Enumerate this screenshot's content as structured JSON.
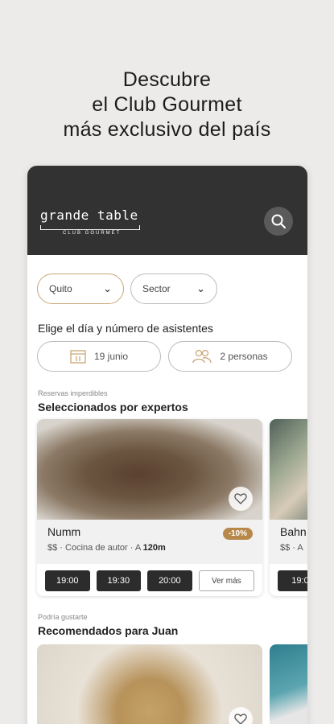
{
  "headline": {
    "line1": "Descubre",
    "line2": "el Club Gourmet",
    "line3": "más exclusivo del país"
  },
  "header": {
    "logo_main": "grande table",
    "logo_sub": "CLUB GOURMET"
  },
  "filters": {
    "city": "Quito",
    "sector": "Sector"
  },
  "pick": {
    "label": "Elige el día y número de asistentes",
    "date": "19 junio",
    "people": "2 personas"
  },
  "section1": {
    "small": "Reservas imperdibles",
    "title": "Seleccionados por expertos"
  },
  "restaurants": [
    {
      "name": "Numm",
      "price": "$$",
      "cuisine": "Cocina de autor",
      "distance_prefix": "A",
      "distance": "120m",
      "discount": "-10%",
      "slots": [
        "19:00",
        "19:30",
        "20:00"
      ],
      "more": "Ver más"
    },
    {
      "name": "Bahn",
      "sub": "$$ · A",
      "slot": "19:0"
    }
  ],
  "section2": {
    "small": "Podría gustarte",
    "title": "Recomendados para Juan"
  },
  "colors": {
    "accent": "#b8884a",
    "header": "#323232"
  }
}
